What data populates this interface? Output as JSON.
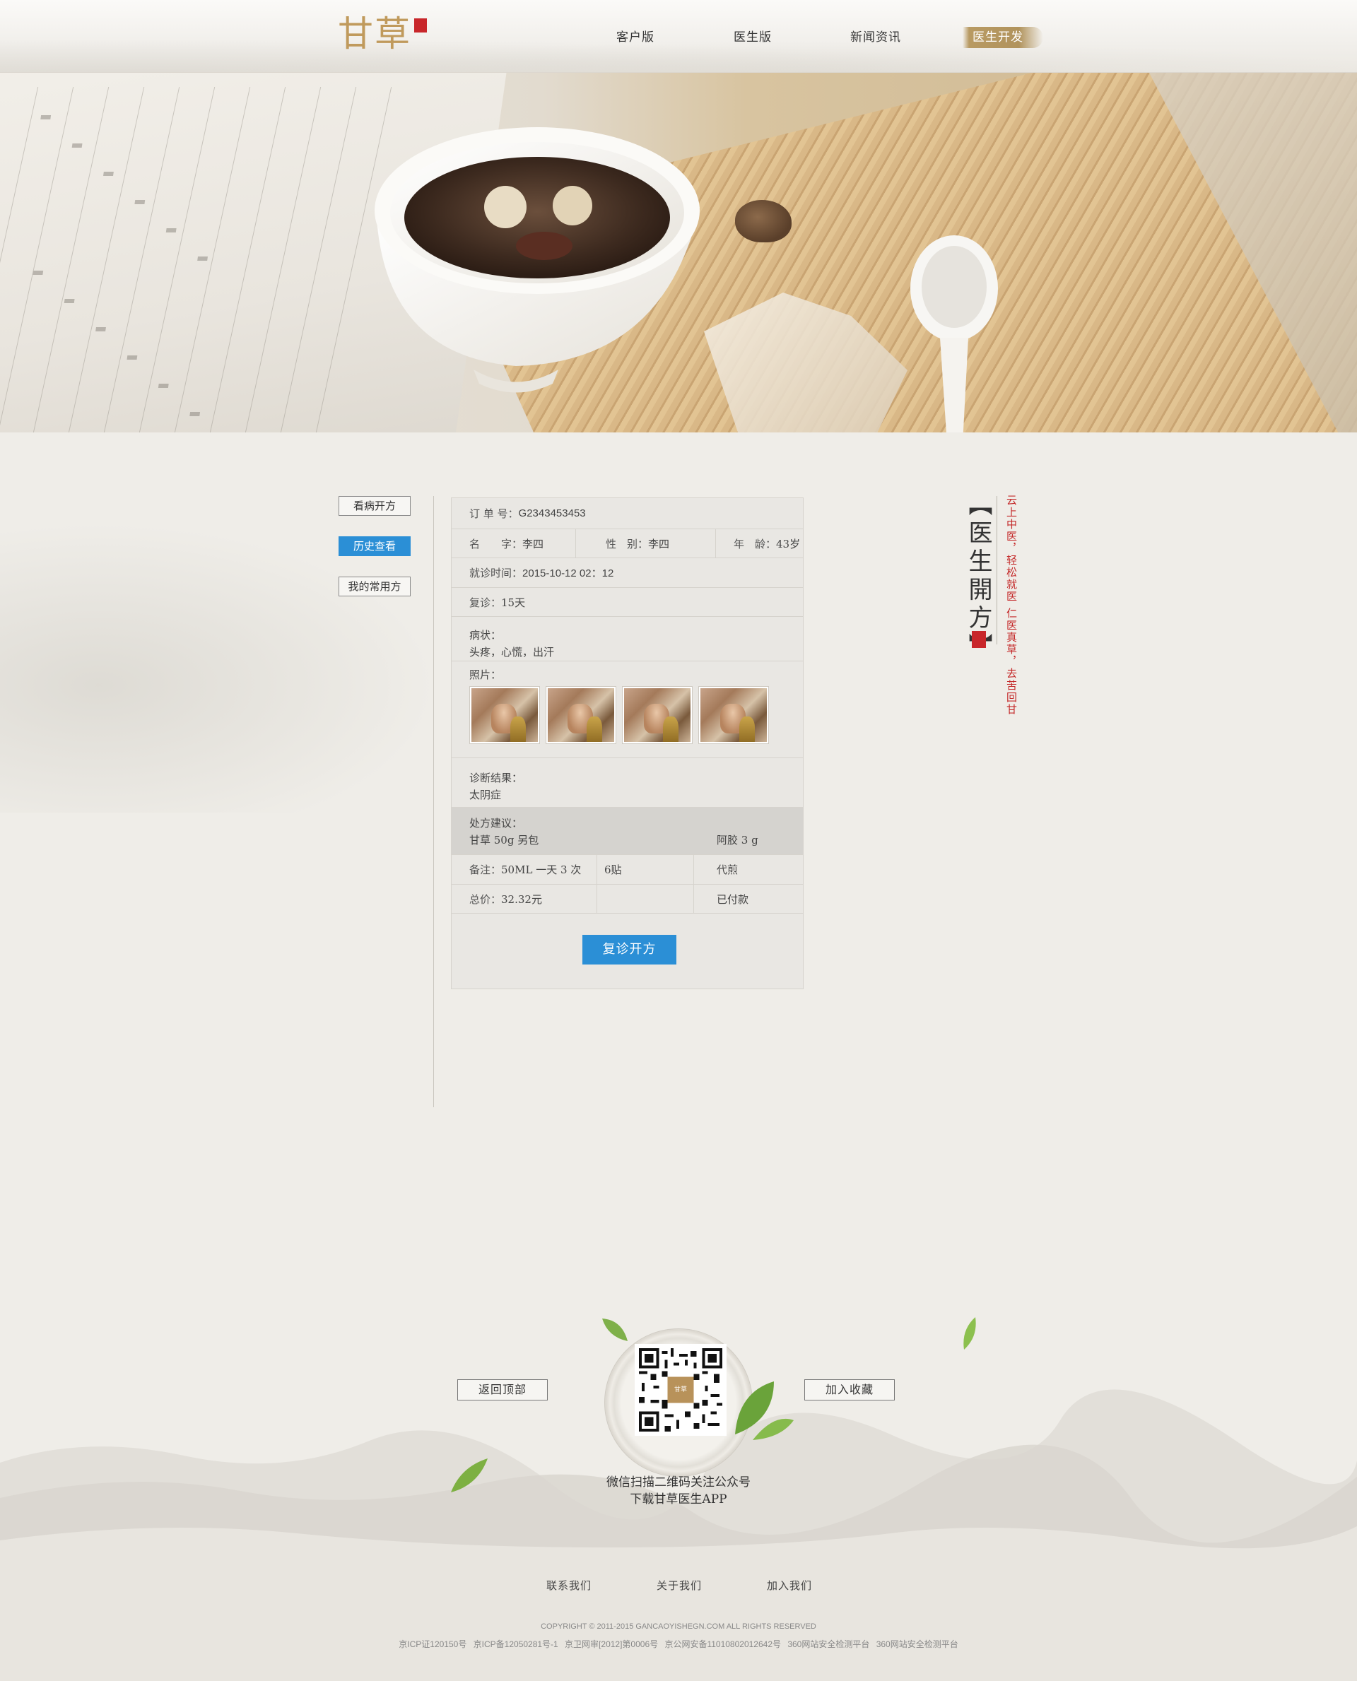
{
  "brand": {
    "logo_text": "甘草",
    "accent_color": "#c09a5c",
    "seal_color": "#c8262a"
  },
  "nav": {
    "items": [
      {
        "label": "客户版"
      },
      {
        "label": "医生版"
      },
      {
        "label": "新闻资讯"
      },
      {
        "label": "医生开发"
      }
    ],
    "active_index": 3
  },
  "sidebar": {
    "items": [
      {
        "label": "看病开方"
      },
      {
        "label": "历史查看"
      },
      {
        "label": "我的常用方"
      }
    ],
    "active_index": 1,
    "active_color": "#2b8fd6"
  },
  "order": {
    "order_no_label": "订 单 号：",
    "order_no": "G2343453453",
    "name_label": "名　　字：",
    "name": "李四",
    "gender_label": "性　别：",
    "gender": "李四",
    "age_label": "年　龄：",
    "age": "43岁",
    "visit_time_label": "就诊时间：",
    "visit_time": "2015-10-12  02：12",
    "revisit_label": "复诊：",
    "revisit": "15天",
    "symptom_label": "病状：",
    "symptom": "头疼，心慌，出汗",
    "photos_label": "照片：",
    "photos": [
      {
        "alt": "photo-1"
      },
      {
        "alt": "photo-2"
      },
      {
        "alt": "photo-3"
      },
      {
        "alt": "photo-4"
      }
    ],
    "diagnosis_label": "诊断结果：",
    "diagnosis": "太阴症",
    "rx_label": "处方建议：",
    "rx_item_1": "甘草  50g 另包",
    "rx_item_2": "阿胶  3 g",
    "note_label": "备注：",
    "note_value": "50ML  一天 3 次",
    "doses": "6贴",
    "decoction": "代煎",
    "total_label": "总价：",
    "total": "32.32元",
    "paid_status": "已付款",
    "submit_label": "复诊开方"
  },
  "side_title": {
    "title": "【医生開方】",
    "subtitle": "云上中医，轻松就医 仁医真草，去苦回甘"
  },
  "footer": {
    "back_top_label": "返回顶部",
    "favorite_label": "加入收藏",
    "qr_center_text": "甘草",
    "qr_caption_1": "微信扫描二维码关注公众号",
    "qr_caption_2": "下载甘草医生APP",
    "links": [
      {
        "label": "联系我们"
      },
      {
        "label": "关于我们"
      },
      {
        "label": "加入我们"
      }
    ],
    "copyright": "COPYRIGHT © 2011-2015 GANCAOYISHEGN.COM ALL RIGHTS RESERVED",
    "icp": "京ICP证120150号  京ICP备12050281号-1  京卫网审[2012]第0006号  京公网安备11010802012642号  360网站安全检测平台  360网站安全检测平台"
  }
}
